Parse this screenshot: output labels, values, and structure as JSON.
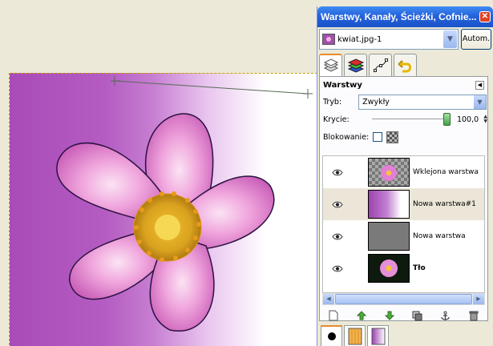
{
  "dock": {
    "title": "Warstwy, Kanały, Ścieżki, Cofnie...",
    "image_name": "kwiat.jpg-1",
    "auto_button": "Autom.",
    "tabs": [
      {
        "icon": "layers-icon",
        "active": true
      },
      {
        "icon": "channels-icon",
        "active": false
      },
      {
        "icon": "paths-icon",
        "active": false
      },
      {
        "icon": "undo-history-icon",
        "active": false
      }
    ]
  },
  "layers_panel": {
    "header": "Warstwy",
    "mode_label": "Tryb:",
    "mode_value": "Zwykły",
    "opacity_label": "Krycie:",
    "opacity_value": "100,0",
    "opacity_level": 1.0,
    "lock_label": "Blokowanie:",
    "layers": [
      {
        "name": "Wklejona warstwa",
        "visible": true,
        "selected": false,
        "bold": false
      },
      {
        "name": "Nowa warstwa#1",
        "visible": true,
        "selected": true,
        "bold": false
      },
      {
        "name": "Nowa warstwa",
        "visible": true,
        "selected": false,
        "bold": false
      },
      {
        "name": "Tło",
        "visible": true,
        "selected": false,
        "bold": true
      }
    ],
    "toolbar": [
      "new-layer-icon",
      "raise-layer-icon",
      "lower-layer-icon",
      "duplicate-layer-icon",
      "anchor-layer-icon",
      "delete-layer-icon"
    ]
  },
  "colors": {
    "titlebar": "#2563dc",
    "selection_row": "#ebe6d7",
    "active_tab_accent": "#e68b2c",
    "canvas_purple": "#a94bb8"
  }
}
